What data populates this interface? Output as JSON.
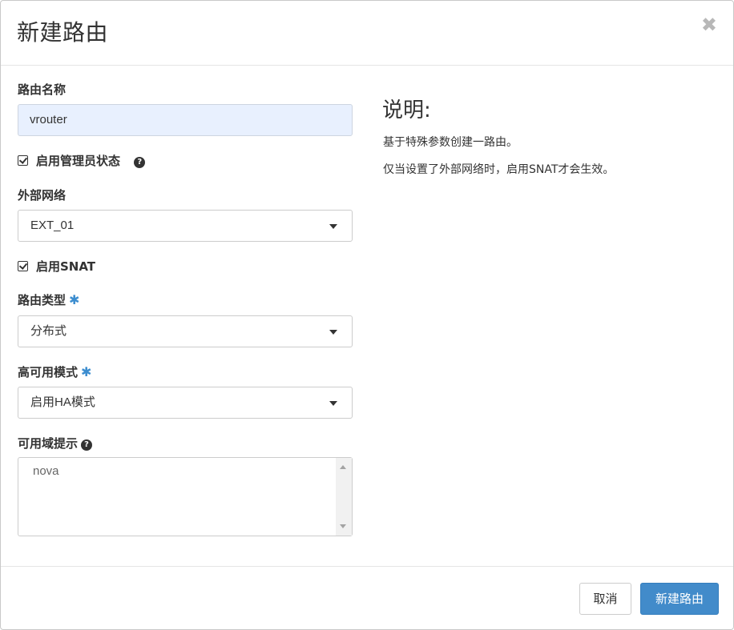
{
  "dialog": {
    "title": "新建路由",
    "close_symbol": "✖"
  },
  "form": {
    "router_name": {
      "label": "路由名称",
      "value": "vrouter"
    },
    "admin_state": {
      "label": "启用管理员状态",
      "checked": true,
      "help_icon": "question-circle-icon"
    },
    "external_network": {
      "label": "外部网络",
      "selected": "EXT_01"
    },
    "enable_snat": {
      "label": "启用SNAT",
      "checked": true
    },
    "router_type": {
      "label": "路由类型",
      "required_mark": "✱",
      "selected": "分布式"
    },
    "ha_mode": {
      "label": "高可用模式",
      "required_mark": "✱",
      "selected": "启用HA模式"
    },
    "availability_zone_hints": {
      "label": "可用域提示",
      "help_icon": "question-circle-icon",
      "value": "nova"
    }
  },
  "description": {
    "title": "说明:",
    "lines": [
      "基于特殊参数创建一路由。",
      "仅当设置了外部网络时，启用SNAT才会生效。"
    ]
  },
  "footer": {
    "cancel_label": "取消",
    "submit_label": "新建路由"
  },
  "colors": {
    "primary_button": "#428bca",
    "required_star": "#3c8dcf",
    "autofill_input_bg": "#e8f0fe"
  }
}
